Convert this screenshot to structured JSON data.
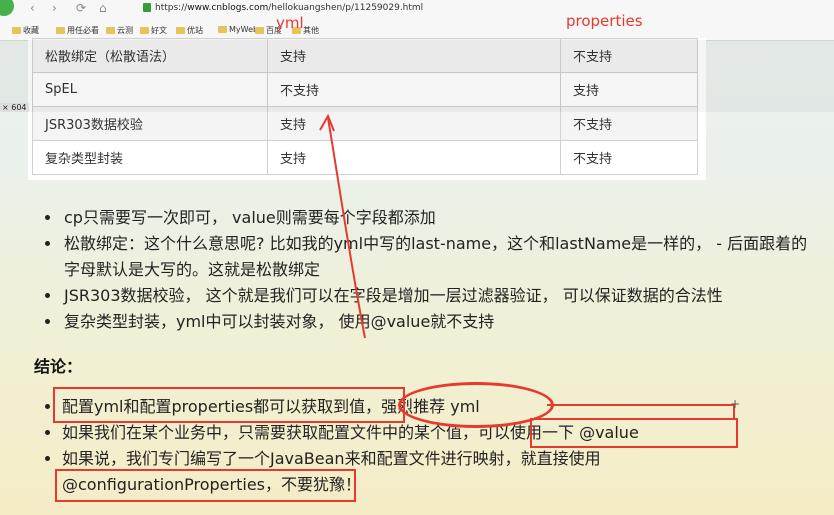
{
  "browser": {
    "back": "‹",
    "forward": "›",
    "reload": "⟳",
    "home": "⌂",
    "url_scheme": "https://",
    "url_host": "www.cnblogs.com",
    "url_path": "/hellokuangshen/p/11259029.html",
    "bookmarks": [
      "收藏",
      "用任必看",
      "云测",
      "好文",
      "优站",
      "MyWeb",
      "百度",
      "其他"
    ]
  },
  "side_tag": "× 604",
  "annotations": {
    "yml": "yml",
    "properties": "properties"
  },
  "table": {
    "rows": [
      {
        "feature": "松散绑定（松散语法）",
        "yml": "支持",
        "properties": "不支持"
      },
      {
        "feature": "SpEL",
        "yml": "不支持",
        "properties": "支持"
      },
      {
        "feature": "JSR303数据校验",
        "yml": "支持",
        "properties": "不支持"
      },
      {
        "feature": "复杂类型封装",
        "yml": "支持",
        "properties": "不支持"
      }
    ]
  },
  "bullets": [
    "cp只需要写一次即可， value则需要每个字段都添加",
    "松散绑定：这个什么意思呢? 比如我的yml中写的last-name，这个和lastName是一样的， - 后面跟着的字母默认是大写的。这就是松散绑定",
    "JSR303数据校验， 这个就是我们可以在字段是增加一层过滤器验证， 可以保证数据的合法性",
    "复杂类型封装，yml中可以封装对象， 使用@value就不支持"
  ],
  "conclusion_title": "结论：",
  "conclusions": {
    "c1_part1": "配置yml和配置properties都可以获取到值，",
    "c1_part2": "强烈推荐 yml",
    "c2": "如果我们在某个业务中，只需要获取配置文件中的某个值，可以使用一下 @value",
    "c3": "如果说，我们专门编写了一个JavaBean来和配置文件进行映射，就直接使用 @configurationProperties，不要犹豫！"
  },
  "colors": {
    "annotation_red": "#e63a2e"
  }
}
